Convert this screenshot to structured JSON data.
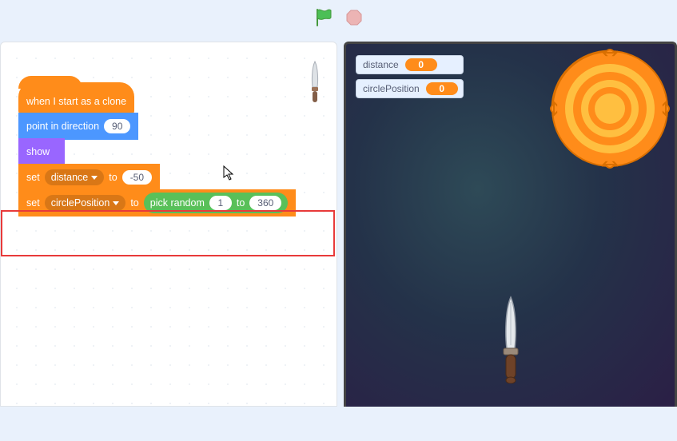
{
  "topbar": {
    "flag": "green-flag",
    "stop": "stop-sign"
  },
  "monitors": [
    {
      "label": "distance",
      "value": "0"
    },
    {
      "label": "circlePosition",
      "value": "0"
    }
  ],
  "script": {
    "hat": "when I start as a clone",
    "point": {
      "label": "point in direction",
      "value": "90"
    },
    "show": "show",
    "set1": {
      "set": "set",
      "var": "distance",
      "to": "to",
      "value": "-50"
    },
    "set2": {
      "set": "set",
      "var": "circlePosition",
      "to": "to",
      "op": {
        "label": "pick random",
        "a": "1",
        "to": "to",
        "b": "360"
      }
    }
  },
  "colors": {
    "orange": "#ff8c1a",
    "blue": "#4c97ff",
    "purple": "#9966ff",
    "green": "#59c059",
    "highlight": "#e83a3a"
  },
  "chart_data": null
}
